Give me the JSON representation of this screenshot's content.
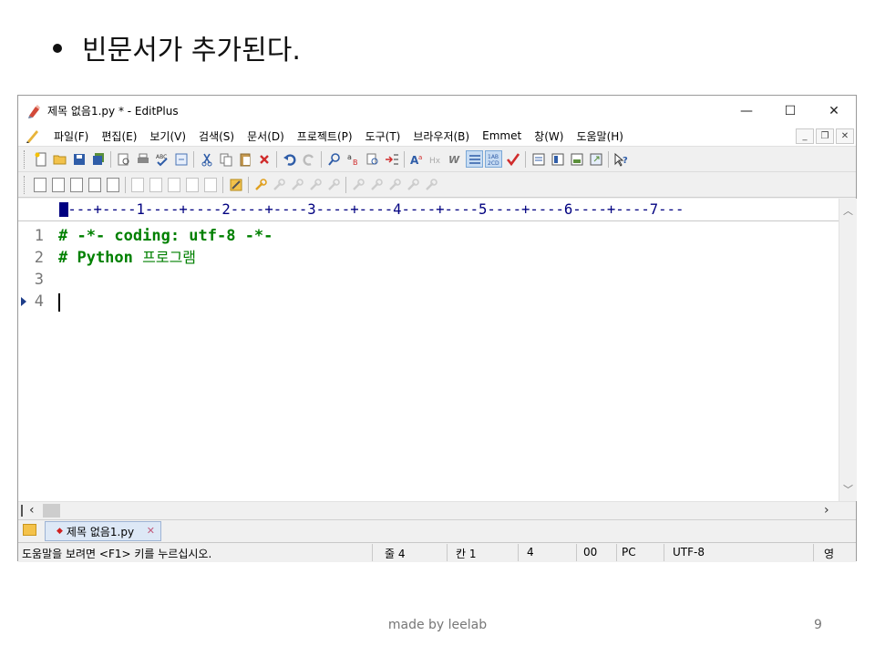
{
  "slide": {
    "bullet_text": "빈문서가 추가된다.",
    "footer": "made by leelab",
    "page_number": "9"
  },
  "window": {
    "title": "제목 없음1.py * - EditPlus",
    "controls": {
      "minimize": "—",
      "maximize": "☐",
      "close": "✕"
    },
    "menu": [
      "파일(F)",
      "편집(E)",
      "보기(V)",
      "검색(S)",
      "문서(D)",
      "프로젝트(P)",
      "도구(T)",
      "브라우저(B)",
      "Emmet",
      "창(W)",
      "도움말(H)"
    ],
    "mdi_controls": {
      "minimize": "_",
      "restore": "❐",
      "close": "✕"
    }
  },
  "ruler": {
    "text": "----+----1----+----2----+----3----+----4----+----5----+----6----+----7---"
  },
  "editor": {
    "lines": [
      {
        "num": "1",
        "code": "# -*- coding: utf-8 -*-",
        "kor": ""
      },
      {
        "num": "2",
        "code": "# Python ",
        "kor": "프로그램"
      },
      {
        "num": "3",
        "code": "",
        "kor": ""
      },
      {
        "num": "4",
        "code": "",
        "kor": ""
      }
    ],
    "current_line": 4
  },
  "tabs": [
    {
      "label": "제목 없음1.py",
      "modified": true,
      "active": true
    }
  ],
  "status": {
    "help": "도움말을 보려면 <F1> 키를 누르십시오.",
    "line": "줄 4",
    "col": "칸 1",
    "lines_count": "4",
    "code": "00",
    "eol": "PC",
    "encoding": "UTF-8",
    "ime": "영"
  },
  "colors": {
    "comment": "#008000",
    "ruler": "#000080",
    "line_number": "#777777"
  }
}
